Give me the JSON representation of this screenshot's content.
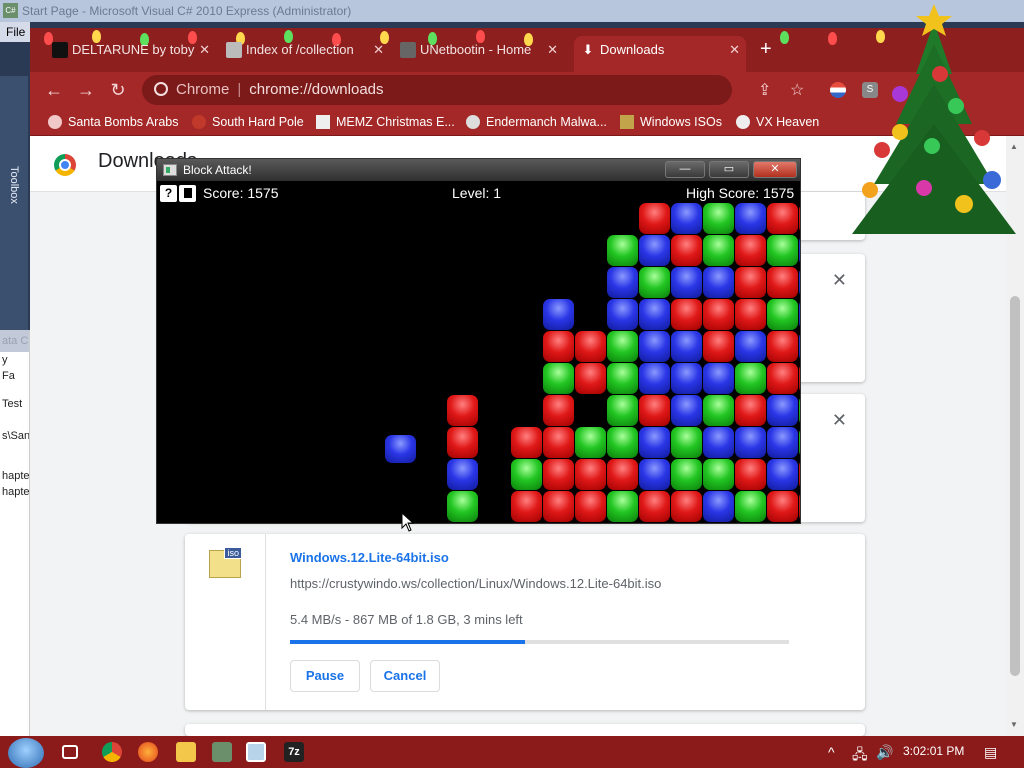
{
  "vs": {
    "title": "Start Page - Microsoft Visual C# 2010 Express (Administrator)",
    "menu_file": "File",
    "toolbox": "Toolbox",
    "left_panel": {
      "header": "ata Ch",
      "rows": [
        "y",
        "Fa",
        "Test",
        "s\\San",
        "hapte",
        "hapte"
      ]
    }
  },
  "chrome": {
    "tabs": [
      {
        "label": "DELTARUNE by toby",
        "favicon_color": "#111111"
      },
      {
        "label": "Index of /collection",
        "favicon_color": "#bbbbbb"
      },
      {
        "label": "UNetbootin - Home",
        "favicon_color": "#666666"
      },
      {
        "label": "Downloads",
        "favicon_color": "#ffffff",
        "active": true
      }
    ],
    "new_tab": "+",
    "omnibox": {
      "scheme_label": "Chrome",
      "url": "chrome://downloads"
    },
    "bookmarks": [
      {
        "label": "Santa Bombs Arabs",
        "icon": "santa-icon"
      },
      {
        "label": "South Hard Pole",
        "icon": "flower-icon"
      },
      {
        "label": "MEMZ Christmas E...",
        "icon": "page-icon"
      },
      {
        "label": "Endermanch Malwa...",
        "icon": "avatar-icon"
      },
      {
        "label": "Windows ISOs",
        "icon": "tree-icon"
      },
      {
        "label": "VX Heaven",
        "icon": "biohazard-icon"
      }
    ],
    "downloads_title": "Downloads",
    "download": {
      "filename": "Windows.12.Lite-64bit.iso",
      "url": "https://crustywindo.ws/collection/Linux/Windows.12.Lite-64bit.iso",
      "status": "5.4 MB/s - 867 MB of 1.8 GB, 3 mins left",
      "progress_percent": 47,
      "pause": "Pause",
      "cancel": "Cancel",
      "icon_tag": "iso"
    },
    "colors": {
      "theme": "#a52828",
      "accent": "#1a73e8"
    }
  },
  "block_attack": {
    "title": "Block Attack!",
    "help": "?",
    "score_label": "Score: 1575",
    "level_label": "Level: 1",
    "high_score_label": "High Score: 1575"
  },
  "taskbar": {
    "clock": "3:02:01 PM",
    "apps": [
      "start-orb",
      "task-view",
      "chrome",
      "firefox",
      "file-explorer",
      "visual-studio",
      "block-attack",
      "7-zip"
    ],
    "tray_7z": "7z"
  }
}
